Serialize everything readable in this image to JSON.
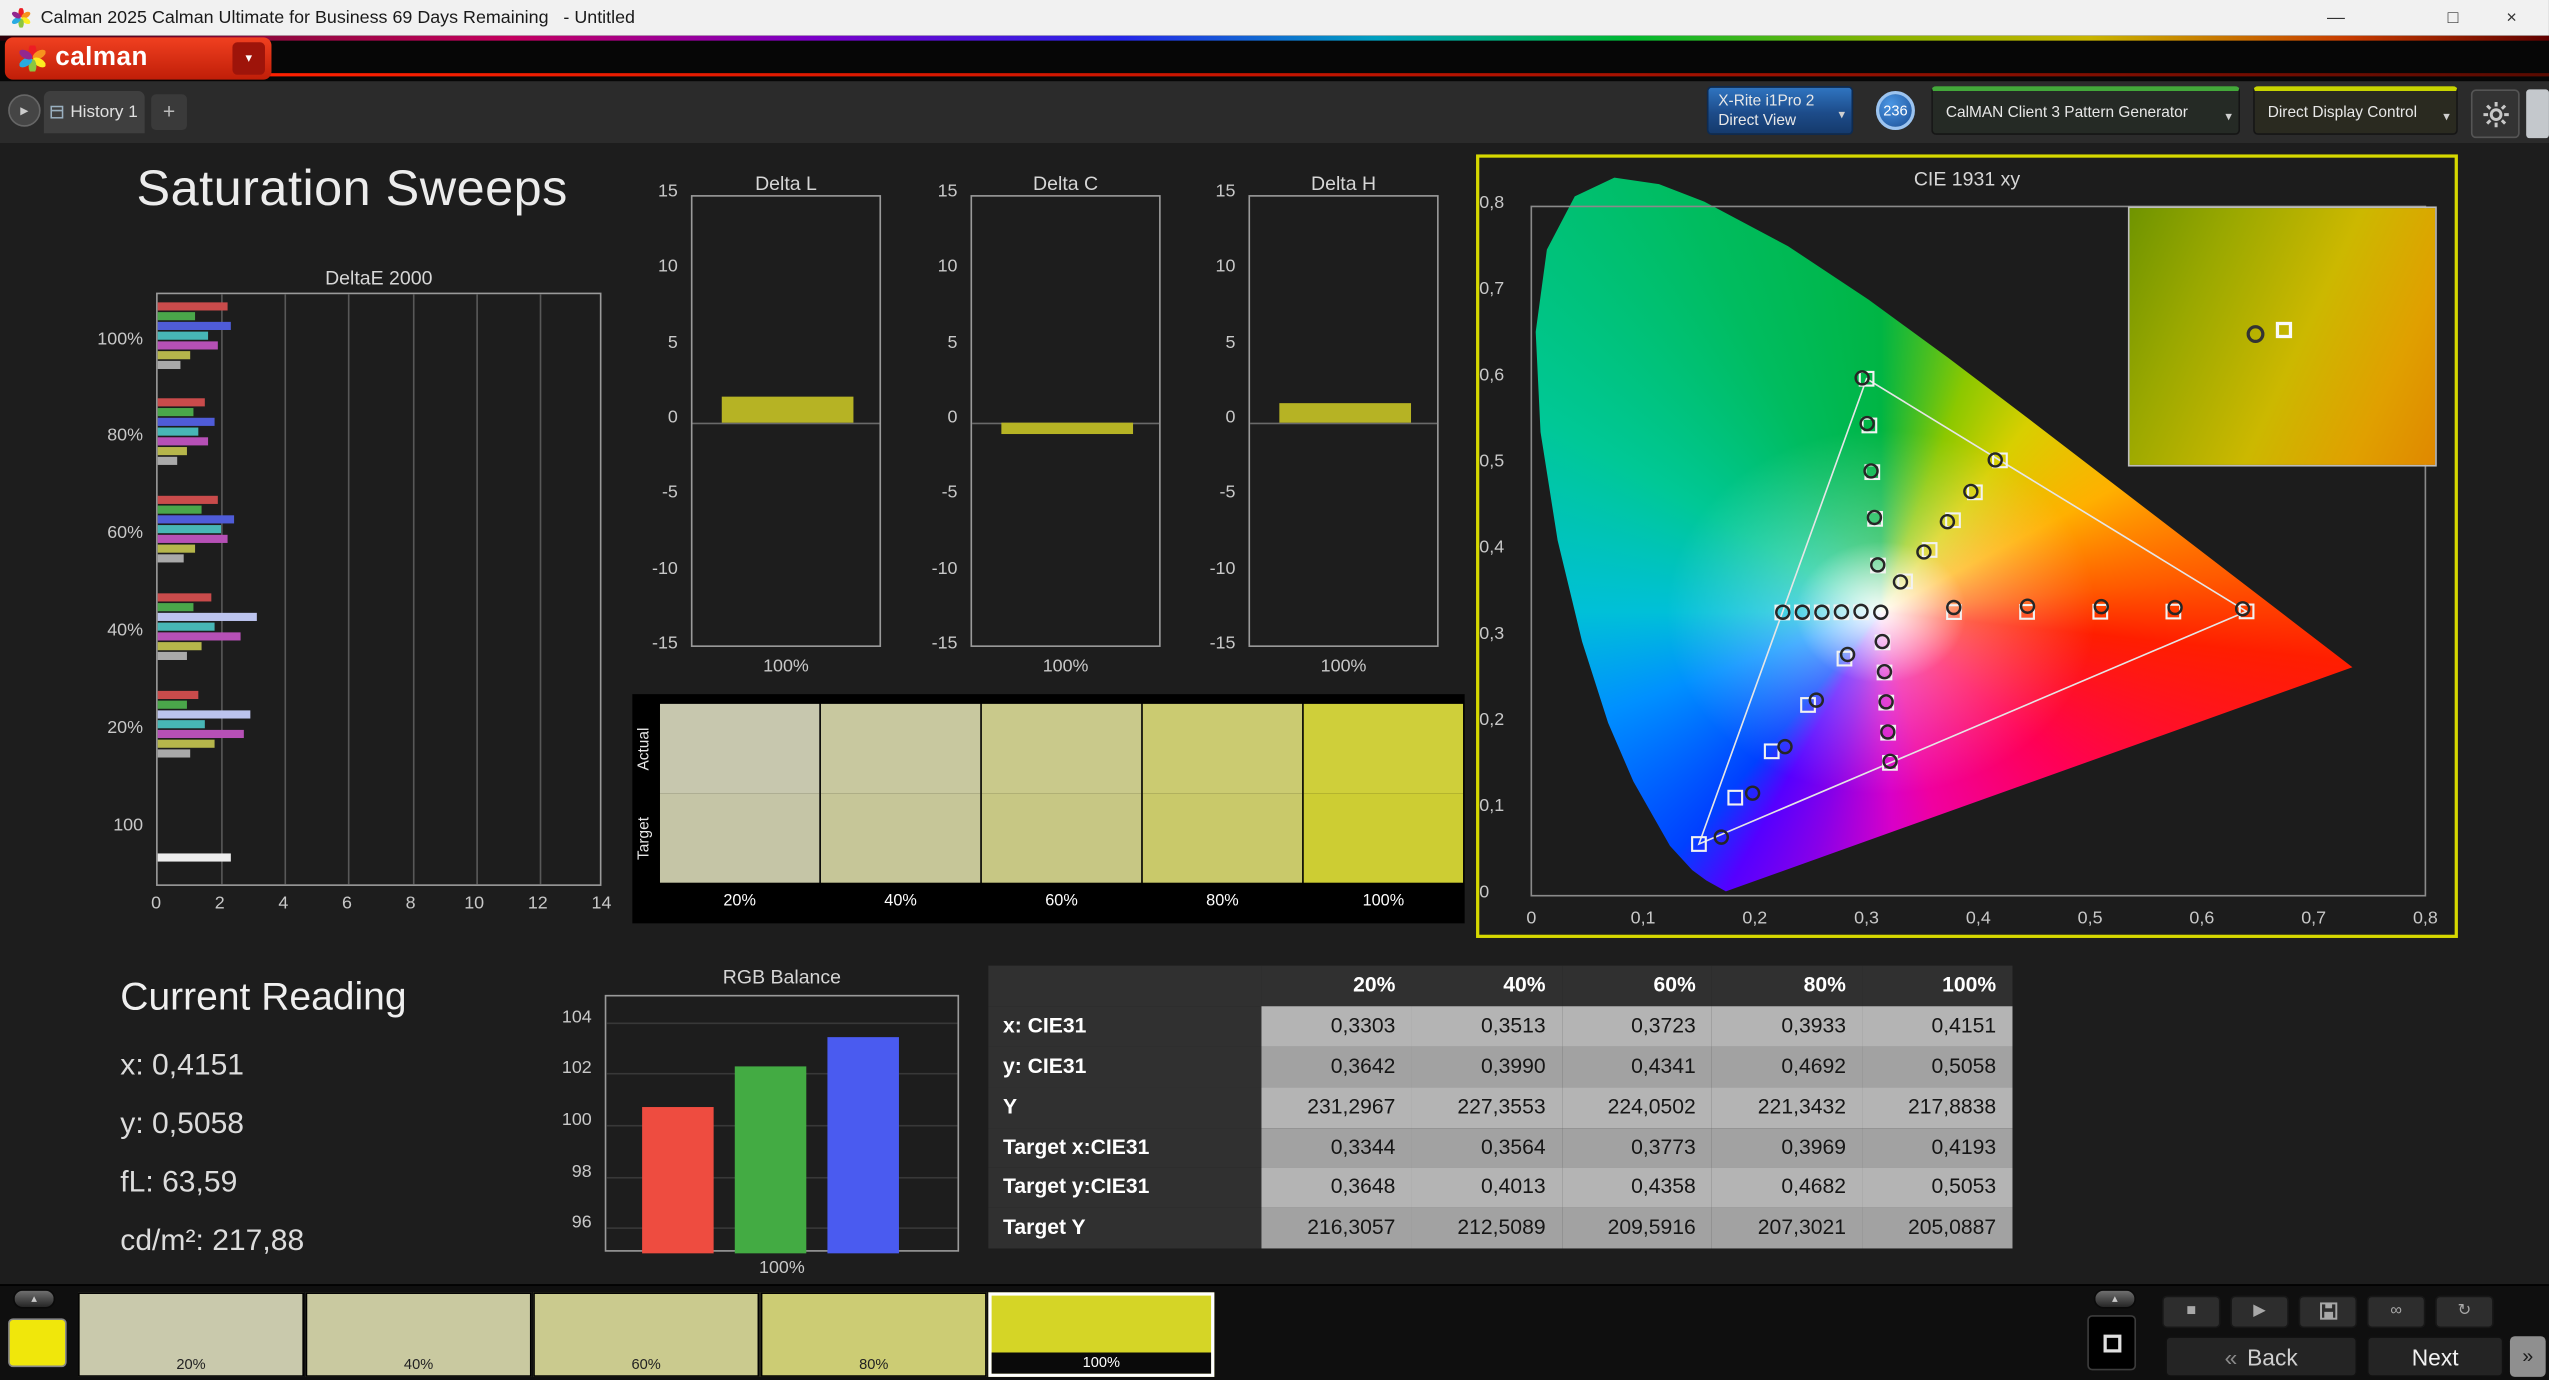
{
  "window": {
    "title": "Calman 2025 Calman Ultimate for Business 69 Days Remaining   - Untitled"
  },
  "icons": {
    "window_minimize": "—",
    "window_maximize": "□",
    "window_close": "×",
    "caret_down": "▾",
    "nav_arrow": "▸",
    "add_tab": "+",
    "mini_arrow": "▴",
    "stop": "■",
    "play": "▶",
    "link": "∞",
    "refresh": "↻",
    "back_chevrons": "«",
    "next_chevrons": "»"
  },
  "header": {
    "logo_text": "calman"
  },
  "tab_bar": {
    "history_tab": "History 1"
  },
  "meter_bar": {
    "meter_device": {
      "line1": "X-Rite i1Pro 2",
      "line2": "Direct View"
    },
    "badge": "236",
    "pattern_source": "CalMAN Client 3 Pattern Generator",
    "display_control": "Direct Display Control"
  },
  "page": {
    "title": "Saturation Sweeps"
  },
  "current_reading": {
    "title": "Current Reading",
    "x": "x: 0,4151",
    "y": "y: 0,5058",
    "fl": "fL: 63,59",
    "cdm2": "cd/m²: 217,88"
  },
  "swatch_strip": {
    "row_labels": [
      "Actual",
      "Target"
    ],
    "patches": [
      {
        "label": "20%",
        "actual": "#c7c7ae",
        "target": "#c5c5a6"
      },
      {
        "label": "40%",
        "actual": "#c8c89f",
        "target": "#c6c698"
      },
      {
        "label": "60%",
        "actual": "#c9c98b",
        "target": "#c7c784"
      },
      {
        "label": "80%",
        "actual": "#cbcb71",
        "target": "#c9c96a"
      },
      {
        "label": "100%",
        "actual": "#cfcf3a",
        "target": "#cdcd33"
      }
    ]
  },
  "table": {
    "columns": [
      "20%",
      "40%",
      "60%",
      "80%",
      "100%"
    ],
    "rows": [
      {
        "label": "x: CIE31",
        "values": [
          "0,3303",
          "0,3513",
          "0,3723",
          "0,3933",
          "0,4151"
        ]
      },
      {
        "label": "y: CIE31",
        "values": [
          "0,3642",
          "0,3990",
          "0,4341",
          "0,4692",
          "0,5058"
        ]
      },
      {
        "label": "Y",
        "values": [
          "231,2967",
          "227,3553",
          "224,0502",
          "221,3432",
          "217,8838"
        ]
      },
      {
        "label": "Target x:CIE31",
        "values": [
          "0,3344",
          "0,3564",
          "0,3773",
          "0,3969",
          "0,4193"
        ]
      },
      {
        "label": "Target y:CIE31",
        "values": [
          "0,3648",
          "0,4013",
          "0,4358",
          "0,4682",
          "0,5053"
        ]
      },
      {
        "label": "Target Y",
        "values": [
          "216,3057",
          "212,5089",
          "209,5916",
          "207,3021",
          "205,0887"
        ]
      }
    ]
  },
  "bottom_bar": {
    "current_swatch_color": "#f0e70b",
    "patches": [
      {
        "label": "20%",
        "color": "#c9c9ac",
        "selected": false
      },
      {
        "label": "40%",
        "color": "#c9c9a0",
        "selected": false
      },
      {
        "label": "60%",
        "color": "#caca8e",
        "selected": false
      },
      {
        "label": "80%",
        "color": "#cccc74",
        "selected": false
      },
      {
        "label": "100%",
        "color": "#d5d526",
        "selected": true
      }
    ],
    "back_label": "Back",
    "next_label": "Next"
  },
  "chart_data": [
    {
      "id": "deltae2000",
      "type": "bar",
      "orientation": "horizontal",
      "title": "DeltaE 2000",
      "xlim": [
        0,
        14
      ],
      "x_ticks": [
        0,
        2,
        4,
        6,
        8,
        10,
        12,
        14
      ],
      "bar_colors": [
        "#c94b4b",
        "#4aa64a",
        "#4f5cd8",
        "#47b6b6",
        "#b650b6",
        "#b6b64b",
        "#a9a9a9"
      ],
      "groups": [
        {
          "label": "100%",
          "values": [
            2.2,
            1.2,
            2.3,
            1.6,
            1.9,
            1.0,
            0.7
          ]
        },
        {
          "label": "80%",
          "values": [
            1.5,
            1.1,
            1.8,
            1.3,
            1.6,
            0.9,
            0.6
          ]
        },
        {
          "label": "60%",
          "values": [
            1.9,
            1.4,
            2.4,
            2.0,
            2.2,
            1.2,
            0.8
          ]
        },
        {
          "label": "40%",
          "values": [
            1.7,
            1.1,
            3.1,
            1.8,
            2.6,
            1.4,
            0.9
          ],
          "colors": [
            "#c94b4b",
            "#4aa64a",
            "#bcc4ee",
            "#47b6b6",
            "#b650b6",
            "#b6b64b",
            "#a9a9a9"
          ]
        },
        {
          "label": "20%",
          "values": [
            1.3,
            0.9,
            2.9,
            1.5,
            2.7,
            1.8,
            1.0
          ],
          "colors": [
            "#c94b4b",
            "#4aa64a",
            "#bcc4ee",
            "#47b6b6",
            "#b650b6",
            "#b6b64b",
            "#a9a9a9"
          ]
        },
        {
          "label": "100",
          "values": [
            2.3
          ],
          "colors": [
            "#ededed"
          ]
        }
      ]
    },
    {
      "id": "deltaL",
      "type": "bar",
      "title": "Delta L",
      "ylim": [
        -15,
        15
      ],
      "y_ticks": [
        15,
        10,
        5,
        0,
        -5,
        -10,
        -15
      ],
      "x_label": "100%",
      "value": 1.7,
      "color": "#b6b324"
    },
    {
      "id": "deltaC",
      "type": "bar",
      "title": "Delta C",
      "ylim": [
        -15,
        15
      ],
      "y_ticks": [
        15,
        10,
        5,
        0,
        -5,
        -10,
        -15
      ],
      "x_label": "100%",
      "value": -0.8,
      "color": "#b6b324"
    },
    {
      "id": "deltaH",
      "type": "bar",
      "title": "Delta H",
      "ylim": [
        -15,
        15
      ],
      "y_ticks": [
        15,
        10,
        5,
        0,
        -5,
        -10,
        -15
      ],
      "x_label": "100%",
      "value": 1.3,
      "color": "#b6b324"
    },
    {
      "id": "rgb_balance",
      "type": "bar",
      "title": "RGB Balance",
      "ylim": [
        95,
        105
      ],
      "y_ticks": [
        104,
        102,
        100,
        98,
        96
      ],
      "x_label": "100%",
      "series": [
        {
          "name": "Red",
          "value": 100.7,
          "color": "#ee4c40"
        },
        {
          "name": "Green",
          "value": 102.3,
          "color": "#43ab43"
        },
        {
          "name": "Blue",
          "value": 103.4,
          "color": "#4a5bf0"
        }
      ]
    },
    {
      "id": "cie1931",
      "type": "scatter",
      "title": "CIE 1931 xy",
      "xlim": [
        0,
        0.8
      ],
      "ylim": [
        0,
        0.8
      ],
      "x_ticks": [
        "0",
        "0,1",
        "0,2",
        "0,3",
        "0,4",
        "0,5",
        "0,6",
        "0,7",
        "0,8"
      ],
      "y_ticks": [
        "0",
        "0,1",
        "0,2",
        "0,3",
        "0,4",
        "0,5",
        "0,6",
        "0,7",
        "0,8"
      ],
      "white_point": [
        0.3127,
        0.329
      ],
      "gamut_triangle": [
        [
          0.64,
          0.33
        ],
        [
          0.3,
          0.6
        ],
        [
          0.15,
          0.06
        ]
      ],
      "measured": [
        [
          0.3127,
          0.329
        ],
        [
          0.3303,
          0.3642
        ],
        [
          0.3513,
          0.399
        ],
        [
          0.3723,
          0.4341
        ],
        [
          0.3933,
          0.4692
        ],
        [
          0.4151,
          0.5058
        ],
        [
          0.378,
          0.3345
        ],
        [
          0.444,
          0.336
        ],
        [
          0.51,
          0.3355
        ],
        [
          0.576,
          0.3345
        ],
        [
          0.6365,
          0.333
        ],
        [
          0.31,
          0.384
        ],
        [
          0.307,
          0.439
        ],
        [
          0.304,
          0.493
        ],
        [
          0.3005,
          0.548
        ],
        [
          0.296,
          0.601
        ],
        [
          0.283,
          0.28
        ],
        [
          0.255,
          0.227
        ],
        [
          0.227,
          0.173
        ],
        [
          0.198,
          0.119
        ],
        [
          0.17,
          0.068
        ],
        [
          0.314,
          0.295
        ],
        [
          0.316,
          0.26
        ],
        [
          0.3175,
          0.225
        ],
        [
          0.319,
          0.19
        ],
        [
          0.321,
          0.156
        ],
        [
          0.295,
          0.33
        ],
        [
          0.2775,
          0.3295
        ],
        [
          0.26,
          0.329
        ],
        [
          0.2425,
          0.329
        ],
        [
          0.225,
          0.329
        ]
      ],
      "targets": [
        [
          0.3344,
          0.3648
        ],
        [
          0.3564,
          0.4013
        ],
        [
          0.3773,
          0.4358
        ],
        [
          0.3969,
          0.4682
        ],
        [
          0.4193,
          0.5053
        ],
        [
          0.3782,
          0.3292
        ],
        [
          0.4436,
          0.3294
        ],
        [
          0.5091,
          0.3296
        ],
        [
          0.5745,
          0.3298
        ],
        [
          0.64,
          0.33
        ],
        [
          0.3102,
          0.3832
        ],
        [
          0.3076,
          0.4374
        ],
        [
          0.3051,
          0.4916
        ],
        [
          0.3025,
          0.5458
        ],
        [
          0.3,
          0.6
        ],
        [
          0.2802,
          0.2752
        ],
        [
          0.2476,
          0.2214
        ],
        [
          0.2151,
          0.1676
        ],
        [
          0.1825,
          0.1138
        ],
        [
          0.15,
          0.06
        ],
        [
          0.3143,
          0.294
        ],
        [
          0.316,
          0.2591
        ],
        [
          0.3176,
          0.2241
        ],
        [
          0.3193,
          0.1892
        ],
        [
          0.3209,
          0.1542
        ],
        [
          0.2951,
          0.3289
        ],
        [
          0.2775,
          0.3289
        ],
        [
          0.2599,
          0.3288
        ],
        [
          0.2422,
          0.3288
        ],
        [
          0.2246,
          0.3287
        ]
      ],
      "inset": {
        "measured": [
          0.4151,
          0.5058
        ],
        "target": [
          0.4193,
          0.5053
        ]
      }
    }
  ]
}
